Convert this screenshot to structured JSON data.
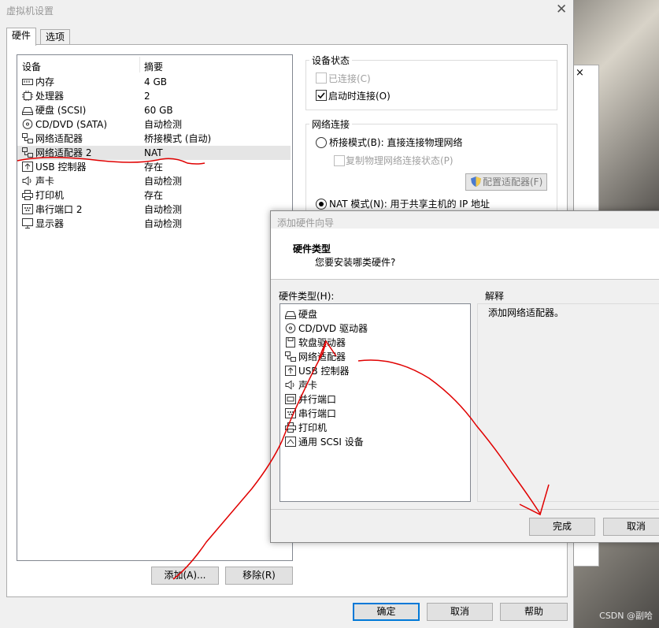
{
  "main_window": {
    "title": "虚拟机设置",
    "tabs": [
      {
        "label": "硬件"
      },
      {
        "label": "选项"
      }
    ],
    "table": {
      "headers": [
        "设备",
        "摘要"
      ],
      "rows": [
        {
          "device": "内存",
          "summary": "4 GB",
          "icon": "memory-icon"
        },
        {
          "device": "处理器",
          "summary": "2",
          "icon": "processor-icon"
        },
        {
          "device": "硬盘 (SCSI)",
          "summary": "60 GB",
          "icon": "hard-disk-icon"
        },
        {
          "device": "CD/DVD (SATA)",
          "summary": "自动检测",
          "icon": "cd-dvd-icon"
        },
        {
          "device": "网络适配器",
          "summary": "桥接模式 (自动)",
          "icon": "network-adapter-icon"
        },
        {
          "device": "网络适配器 2",
          "summary": "NAT",
          "icon": "network-adapter-icon"
        },
        {
          "device": "USB 控制器",
          "summary": "存在",
          "icon": "usb-icon"
        },
        {
          "device": "声卡",
          "summary": "自动检测",
          "icon": "sound-card-icon"
        },
        {
          "device": "打印机",
          "summary": "存在",
          "icon": "printer-icon"
        },
        {
          "device": "串行端口 2",
          "summary": "自动检测",
          "icon": "serial-port-icon"
        },
        {
          "device": "显示器",
          "summary": "自动检测",
          "icon": "display-icon"
        }
      ]
    },
    "add_button": "添加(A)...",
    "remove_button": "移除(R)",
    "device_status": {
      "title": "设备状态",
      "connected": {
        "label": "已连接(C)",
        "checked": false,
        "enabled": false
      },
      "connect_at_power_on": {
        "label": "启动时连接(O)",
        "checked": true
      }
    },
    "network_connection": {
      "title": "网络连接",
      "bridged": {
        "label": "桥接模式(B): 直接连接物理网络",
        "selected": false
      },
      "replicate_state": {
        "label": "复制物理网络连接状态(P)",
        "checked": false,
        "enabled": false
      },
      "configure_adapters_button": "配置适配器(F)",
      "nat": {
        "label": "NAT 模式(N): 用于共享主机的 IP 地址",
        "selected": true
      }
    },
    "footer_buttons": {
      "ok": "确定",
      "cancel": "取消",
      "help": "帮助"
    }
  },
  "wizard": {
    "title": "添加硬件向导",
    "heading": "硬件类型",
    "subheading": "您要安装哪类硬件?",
    "list_label": "硬件类型(H):",
    "items": [
      {
        "label": "硬盘",
        "icon": "hard-disk-icon"
      },
      {
        "label": "CD/DVD 驱动器",
        "icon": "cd-dvd-icon"
      },
      {
        "label": "软盘驱动器",
        "icon": "floppy-icon"
      },
      {
        "label": "网络适配器",
        "icon": "network-adapter-icon"
      },
      {
        "label": "USB 控制器",
        "icon": "usb-icon"
      },
      {
        "label": "声卡",
        "icon": "sound-card-icon"
      },
      {
        "label": "并行端口",
        "icon": "parallel-port-icon"
      },
      {
        "label": "串行端口",
        "icon": "serial-port-icon"
      },
      {
        "label": "打印机",
        "icon": "printer-icon"
      },
      {
        "label": "通用 SCSI 设备",
        "icon": "scsi-device-icon"
      }
    ],
    "description_label": "解释",
    "description": "添加网络适配器。",
    "finish_button": "完成",
    "cancel_button": "取消"
  },
  "background_window": {
    "close_glyph": "×"
  },
  "watermark": "CSDN @副哈",
  "colors": {
    "annotation": "#e00000",
    "accent": "#0078d7"
  }
}
